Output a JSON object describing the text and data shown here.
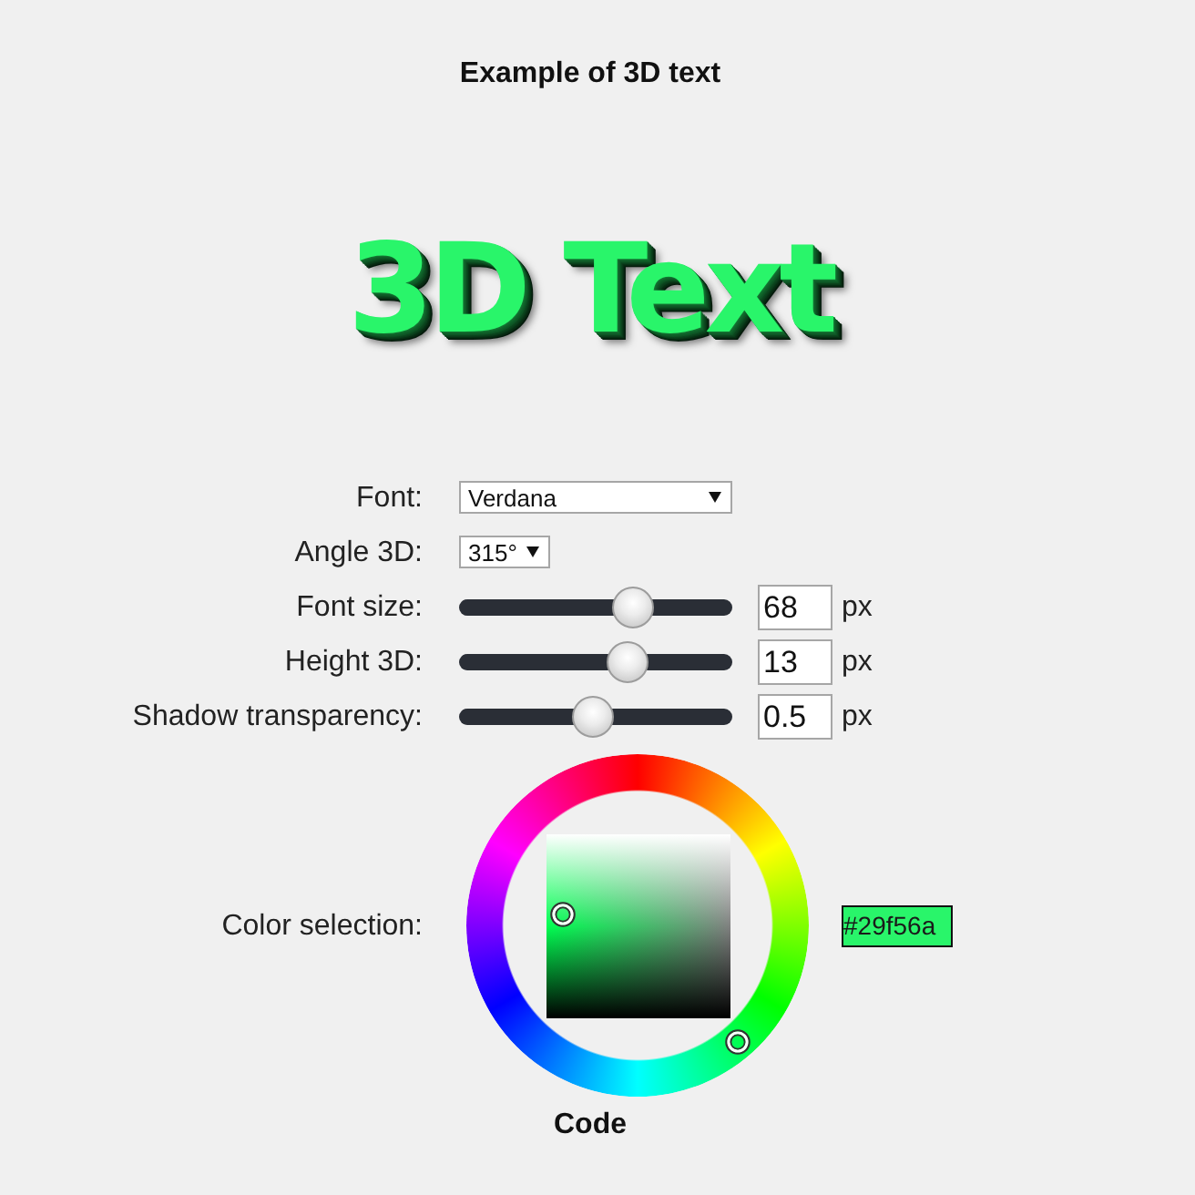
{
  "title": "Example of 3D text",
  "preview": {
    "text": "3D Text"
  },
  "settings": [
    {
      "kind": "select",
      "label": "Font:",
      "value": "Verdana"
    },
    {
      "kind": "select",
      "label": "Angle 3D:",
      "value": "315°"
    },
    {
      "kind": "slider",
      "label": "Font size:",
      "level": 0.66,
      "value": "68",
      "unit": "px"
    },
    {
      "kind": "slider",
      "label": "Height 3D:",
      "level": 0.64,
      "value": "13",
      "unit": "px"
    },
    {
      "kind": "slider",
      "label": "Shadow transparency:",
      "level": 0.49,
      "value": "0.5",
      "unit": "px"
    },
    {
      "kind": "color",
      "label": "Color selection:",
      "value": "#29f56a"
    }
  ],
  "code_heading": "Code"
}
